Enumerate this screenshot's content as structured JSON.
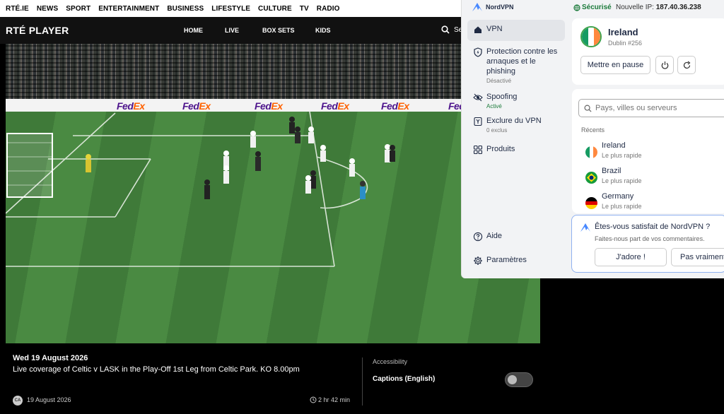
{
  "site_nav": [
    "RTÉ.IE",
    "NEWS",
    "SPORT",
    "ENTERTAINMENT",
    "BUSINESS",
    "LIFESTYLE",
    "CULTURE",
    "TV",
    "RADIO"
  ],
  "player": {
    "logo_main": "RTÉ",
    "logo_player": "PLAYER",
    "nav": [
      "HOME",
      "LIVE",
      "BOX SETS",
      "KIDS"
    ],
    "search_label": "Se"
  },
  "video": {
    "ad_board": "FedEx",
    "ad_board_fe": "Fed",
    "ad_board_ex": "Ex"
  },
  "programme": {
    "date": "Wed 19 August 2026",
    "description": "Live coverage of Celtic v LASK in the Play-Off 1st Leg from Celtic Park. KO 8.00pm",
    "avatar_initials": "CA",
    "aired": "19 August 2026",
    "duration": "2 hr 42 min",
    "accessibility_label": "Accessibility",
    "captions_label": "Captions (English)",
    "captions_on": false
  },
  "vpn": {
    "brand": "NordVPN",
    "status": "Sécurisé",
    "new_ip_label": "Nouvelle IP:",
    "new_ip": "187.40.36.238",
    "sidebar": [
      {
        "label": "VPN",
        "sub": "",
        "icon": "home-icon"
      },
      {
        "label": "Protection contre les arnaques et le phishing",
        "sub": "Désactivé",
        "icon": "shield-bolt-icon"
      },
      {
        "label": "Spoofing",
        "sub": "Activé",
        "icon": "eye-off-icon"
      },
      {
        "label": "Exclure du VPN",
        "sub": "0 exclus",
        "icon": "split-tunnel-icon"
      },
      {
        "label": "Produits",
        "sub": "",
        "icon": "grid-icon"
      },
      {
        "label": "Aide",
        "sub": "",
        "icon": "help-icon"
      },
      {
        "label": "Paramètres",
        "sub": "",
        "icon": "gear-icon"
      }
    ],
    "connection": {
      "country": "Ireland",
      "server": "Dublin #256",
      "pause_label": "Mettre en pause"
    },
    "search_placeholder": "Pays, villes ou serveurs",
    "recents_label": "Récents",
    "recents": [
      {
        "country": "Ireland",
        "sub": "Le plus rapide"
      },
      {
        "country": "Brazil",
        "sub": "Le plus rapide"
      },
      {
        "country": "Germany",
        "sub": "Le plus rapide"
      }
    ],
    "feedback": {
      "title": "Êtes-vous satisfait de NordVPN ?",
      "subtitle": "Faites-nous part de vos commentaires.",
      "love_label": "J'adore !",
      "not_really_label": "Pas vraiment"
    },
    "colors": {
      "accent": "#4687ff",
      "secure": "#1b7a3a",
      "ie_green": "#169b62",
      "ie_orange": "#ff883e"
    }
  }
}
